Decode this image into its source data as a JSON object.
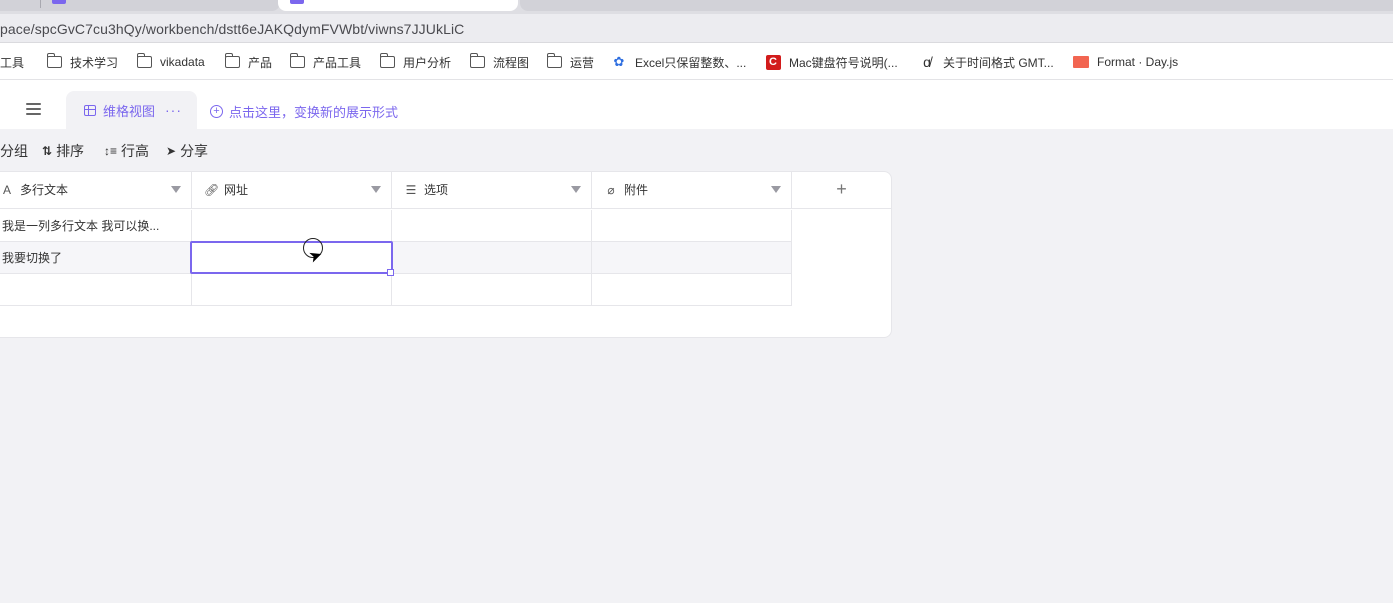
{
  "browser": {
    "url": "pace/spcGvC7cu3hQy/workbench/dstt6eJAKQdymFVWbt/viwns7JJUkLiC"
  },
  "bookmarks": [
    {
      "label": "常工具",
      "icon": "folder-icon"
    },
    {
      "label": "技术学习",
      "icon": "folder-icon"
    },
    {
      "label": "vikadata",
      "icon": "folder-icon"
    },
    {
      "label": "产品",
      "icon": "folder-icon"
    },
    {
      "label": "产品工具",
      "icon": "folder-icon"
    },
    {
      "label": "用户分析",
      "icon": "folder-icon"
    },
    {
      "label": "流程图",
      "icon": "folder-icon"
    },
    {
      "label": "运营",
      "icon": "folder-icon"
    },
    {
      "label": "Excel只保留整数、...",
      "icon": "baidu-paw-icon"
    },
    {
      "label": "Mac键盘符号说明(...",
      "icon": "c-logo-icon"
    },
    {
      "label": "关于时间格式 GMT...",
      "icon": "alpha-icon"
    },
    {
      "label": "Format · Day.js",
      "icon": "dayjs-icon"
    }
  ],
  "view": {
    "tab_label": "维格视图",
    "more": "···",
    "add_view_hint": "点击这里，变换新的展示形式"
  },
  "toolbar": {
    "group": "分组",
    "sort": "排序",
    "row_height": "行高",
    "share": "分享"
  },
  "grid": {
    "columns": [
      {
        "name": "多行文本",
        "icon": "text-icon"
      },
      {
        "name": "网址",
        "icon": "link-icon"
      },
      {
        "name": "选项",
        "icon": "options-icon"
      },
      {
        "name": "附件",
        "icon": "attachment-icon"
      }
    ],
    "add_column": "+",
    "rows": [
      [
        "我是一列多行文本 我可以换...",
        "",
        "",
        ""
      ],
      [
        "我要切换了",
        "",
        "",
        ""
      ],
      [
        "",
        "",
        "",
        ""
      ]
    ]
  },
  "colors": {
    "accent": "#7b67ee",
    "background": "#f2f2f5"
  }
}
